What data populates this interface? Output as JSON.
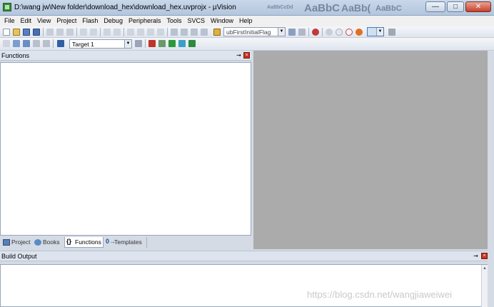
{
  "window": {
    "title": "D:\\wang jw\\New folder\\download_hex\\download_hex.uvprojx - µVision",
    "ribbon_ghost": [
      "AaBbCcDd",
      "AaBbC",
      "AaBb(",
      "AaBbC"
    ]
  },
  "menu": [
    "File",
    "Edit",
    "View",
    "Project",
    "Flash",
    "Debug",
    "Peripherals",
    "Tools",
    "SVCS",
    "Window",
    "Help"
  ],
  "toolbar1": {
    "find_combo": "ubFirstInitialFlag"
  },
  "toolbar2": {
    "target_combo": "Target 1"
  },
  "functions_pane": {
    "title": "Functions",
    "pin": "▕",
    "close": "x"
  },
  "tabs": [
    {
      "label": "Project",
      "icon": "project-icon",
      "active": false
    },
    {
      "label": "Books",
      "icon": "books-icon",
      "active": false
    },
    {
      "label": "Functions",
      "icon": "functions-icon",
      "active": true
    },
    {
      "label": "Templates",
      "icon": "templates-icon",
      "active": false
    }
  ],
  "build_output": {
    "title": "Build Output"
  },
  "watermark": "https://blog.csdn.net/wangjiaweiwei",
  "colors": {
    "workspace_gray": "#ababab",
    "accent_close": "#c8321e"
  }
}
